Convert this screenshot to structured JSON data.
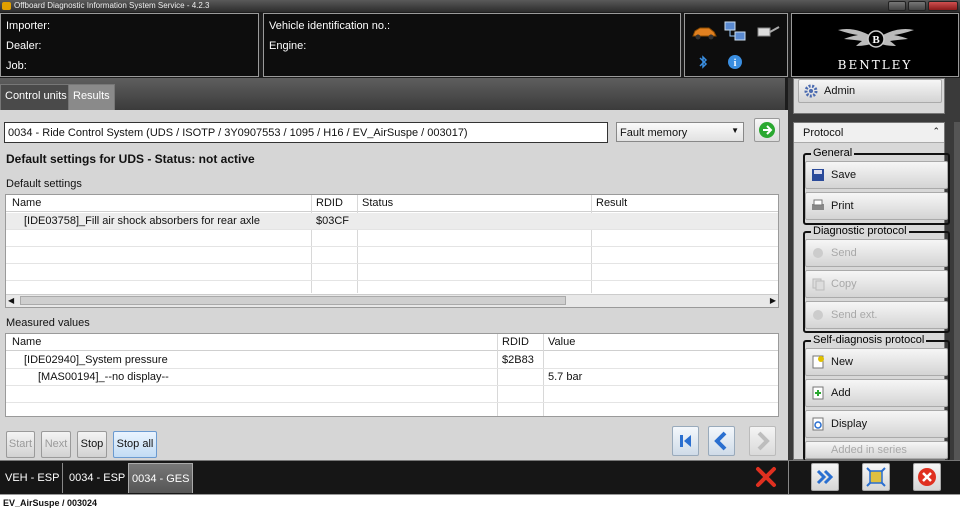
{
  "window": {
    "title": "Offboard Diagnostic Information System Service - 4.2.3"
  },
  "info": {
    "importer_label": "Importer:",
    "dealer_label": "Dealer:",
    "job_label": "Job:",
    "vin_label": "Vehicle identification no.:",
    "engine_label": "Engine:"
  },
  "brand": {
    "name": "BENTLEY"
  },
  "tabs": [
    {
      "label": "Control units"
    },
    {
      "label": "Results"
    }
  ],
  "main": {
    "control_unit": "0034 - Ride Control System  (UDS / ISOTP / 3Y0907553 / 1095 / H16 / EV_AirSuspe / 003017)",
    "mode_select": "Fault memory",
    "heading": "Default settings for UDS - Status: not active",
    "default_settings": {
      "label": "Default settings",
      "columns": [
        "Name",
        "RDID",
        "Status",
        "Result"
      ],
      "rows": [
        {
          "name": "[IDE03758]_Fill air shock absorbers for rear axle",
          "rdid": "$03CF",
          "status": "",
          "result": ""
        }
      ]
    },
    "measured_values": {
      "label": "Measured values",
      "columns": [
        "Name",
        "RDID",
        "Value"
      ],
      "rows": [
        {
          "name": "[IDE02940]_System pressure",
          "rdid": "$2B83",
          "value": ""
        },
        {
          "name": "[MAS00194]_--no display--",
          "rdid": "",
          "value": "5.7 bar"
        }
      ]
    },
    "buttons": {
      "start": "Start",
      "next": "Next",
      "stop": "Stop",
      "stop_all": "Stop all"
    }
  },
  "right_panel": {
    "admin": "Admin",
    "protocol": "Protocol",
    "general": {
      "title": "General",
      "save": "Save",
      "print": "Print"
    },
    "diagnostic": {
      "title": "Diagnostic protocol",
      "send": "Send",
      "copy": "Copy",
      "send_ext": "Send ext."
    },
    "self_diag": {
      "title": "Self-diagnosis protocol",
      "new": "New",
      "add": "Add",
      "display": "Display",
      "added": "Added in series"
    }
  },
  "bottom_tabs": [
    {
      "label": "VEH - ESP"
    },
    {
      "label": "0034 - ESP"
    },
    {
      "label": "0034 - GES"
    }
  ],
  "status": {
    "text": "EV_AirSuspe / 003024"
  },
  "colors": {
    "accent_blue": "#2a6fd0",
    "close_red": "#e03020",
    "go_green": "#2aa830"
  }
}
